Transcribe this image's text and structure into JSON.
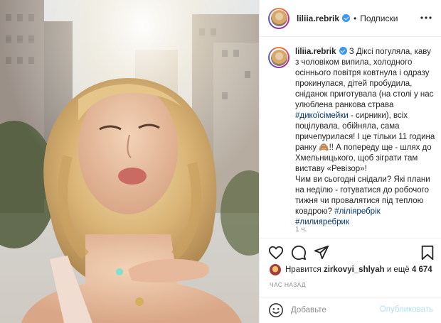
{
  "post": {
    "username": "liliia.rebrik",
    "follow_label": "Подписки",
    "dot_separator": "•",
    "caption_parts": [
      {
        "text": "З Діксі погуляла, каву з чоловіком випила, холодного осіннього повітря ковтнула і одразу прокинулася, дітей пробудила, сніданок приготувала (на столі у нас улюблена ранкова страва ",
        "type": "text"
      },
      {
        "text": "#дикоїсімейки",
        "type": "hashtag"
      },
      {
        "text": " - сирники), всіх поцілувала, обійняла, сама причепурилася! І це тільки 11 година ранку 🙈!! А попереду ще - шлях до Хмельницького, щоб зіграти там виставу «Ревізор»!\nЧим ви сьогодні снідали? Які плани на неділю - готуватися до робочого тижня чи провалятися під теплою ковдрою? ",
        "type": "text"
      },
      {
        "text": "#ліліяребрік",
        "type": "hashtag"
      },
      {
        "text": "\n",
        "type": "text"
      },
      {
        "text": "#лилияребрик",
        "type": "hashtag"
      }
    ],
    "time_ago": "1 ч.",
    "likes_prefix": "Нравится ",
    "likes_user": "zirkovyi_shlyah",
    "likes_middle": " и ещё ",
    "likes_count": "4 674",
    "post_date": "ЧАС НАЗАД",
    "comment_placeholder": "Добавьте",
    "publish_label": "Опубликовать"
  },
  "icons": {
    "more": "more-horizontal-icon",
    "like": "heart-icon",
    "comment": "comment-bubble-icon",
    "share": "paper-plane-icon",
    "save": "bookmark-icon",
    "emoji": "smiley-icon",
    "verified": "verified-badge-icon"
  },
  "colors": {
    "verified": "#3897f0",
    "hashtag": "#00376b",
    "muted": "#8e8e8e",
    "publish_disabled": "#b2dffc",
    "text": "#262626"
  }
}
